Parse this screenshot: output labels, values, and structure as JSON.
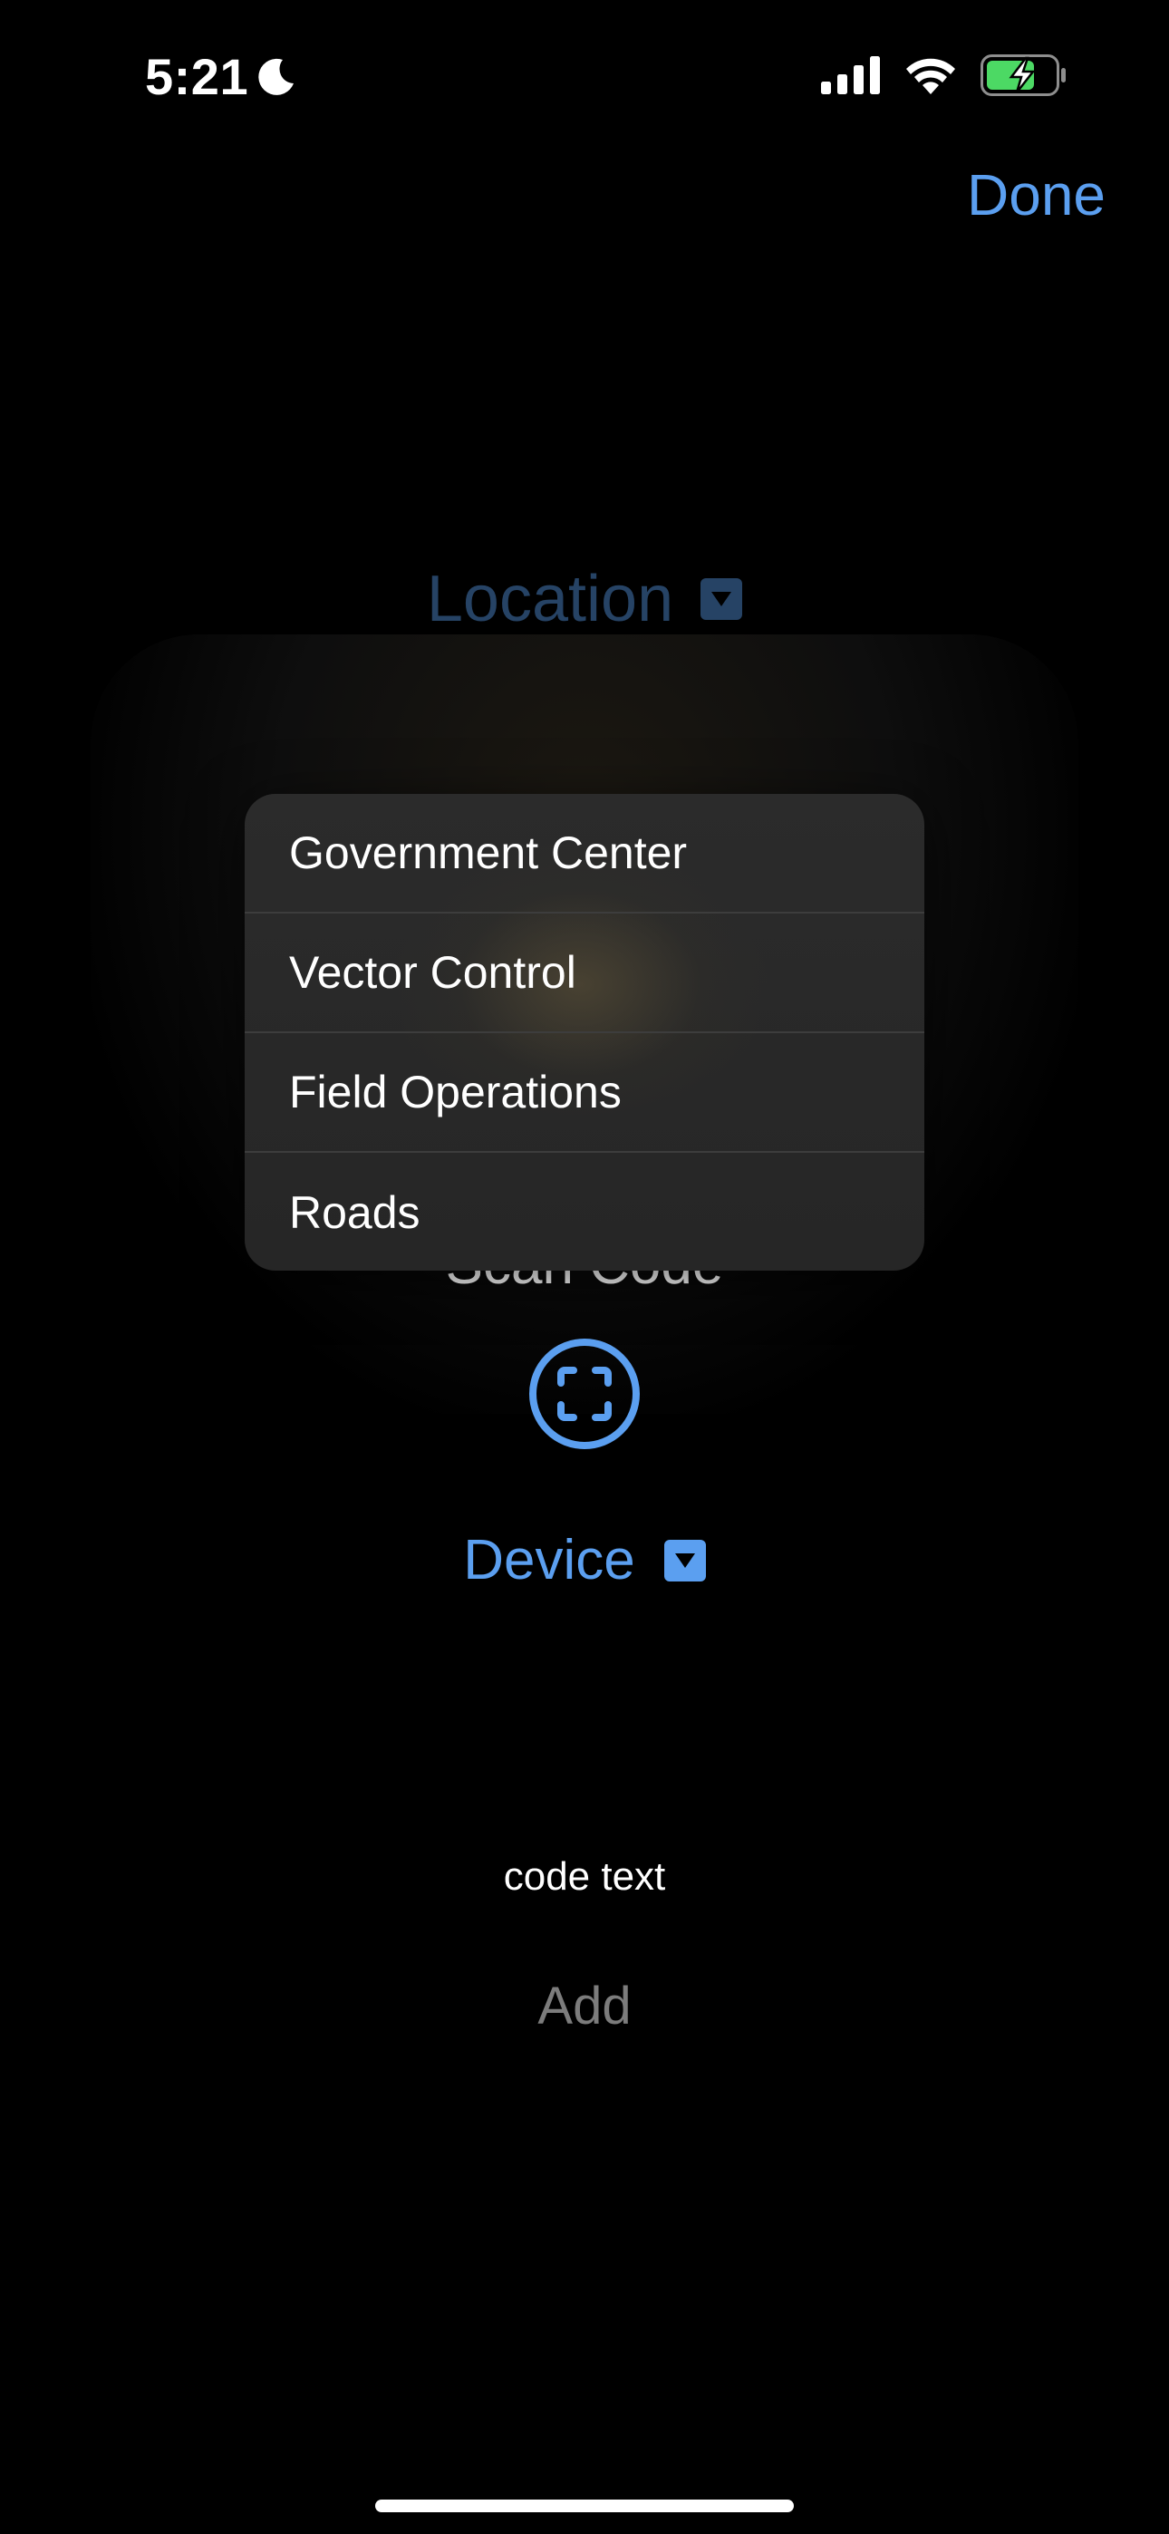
{
  "status_bar": {
    "time": "5:21",
    "icons": [
      "moon-icon",
      "cellular-signal-icon",
      "wifi-icon",
      "battery-charging-icon"
    ]
  },
  "nav": {
    "done_label": "Done"
  },
  "location": {
    "label": "Location",
    "icon": "dropdown-arrow-icon"
  },
  "menu": {
    "items": [
      {
        "label": "Government Center"
      },
      {
        "label": "Vector Control"
      },
      {
        "label": "Field Operations"
      },
      {
        "label": "Roads"
      }
    ]
  },
  "scan": {
    "label": "Scan Code",
    "icon": "scan-viewfinder-icon"
  },
  "device": {
    "label": "Device",
    "icon": "dropdown-arrow-icon"
  },
  "code": {
    "text": "code text",
    "add_label": "Add"
  },
  "colors": {
    "accent": "#5b9ff0",
    "background": "#000000",
    "menu_background": "#2b2b2b",
    "secondary_text": "#7c7c7c",
    "battery_green": "#4cd964"
  }
}
